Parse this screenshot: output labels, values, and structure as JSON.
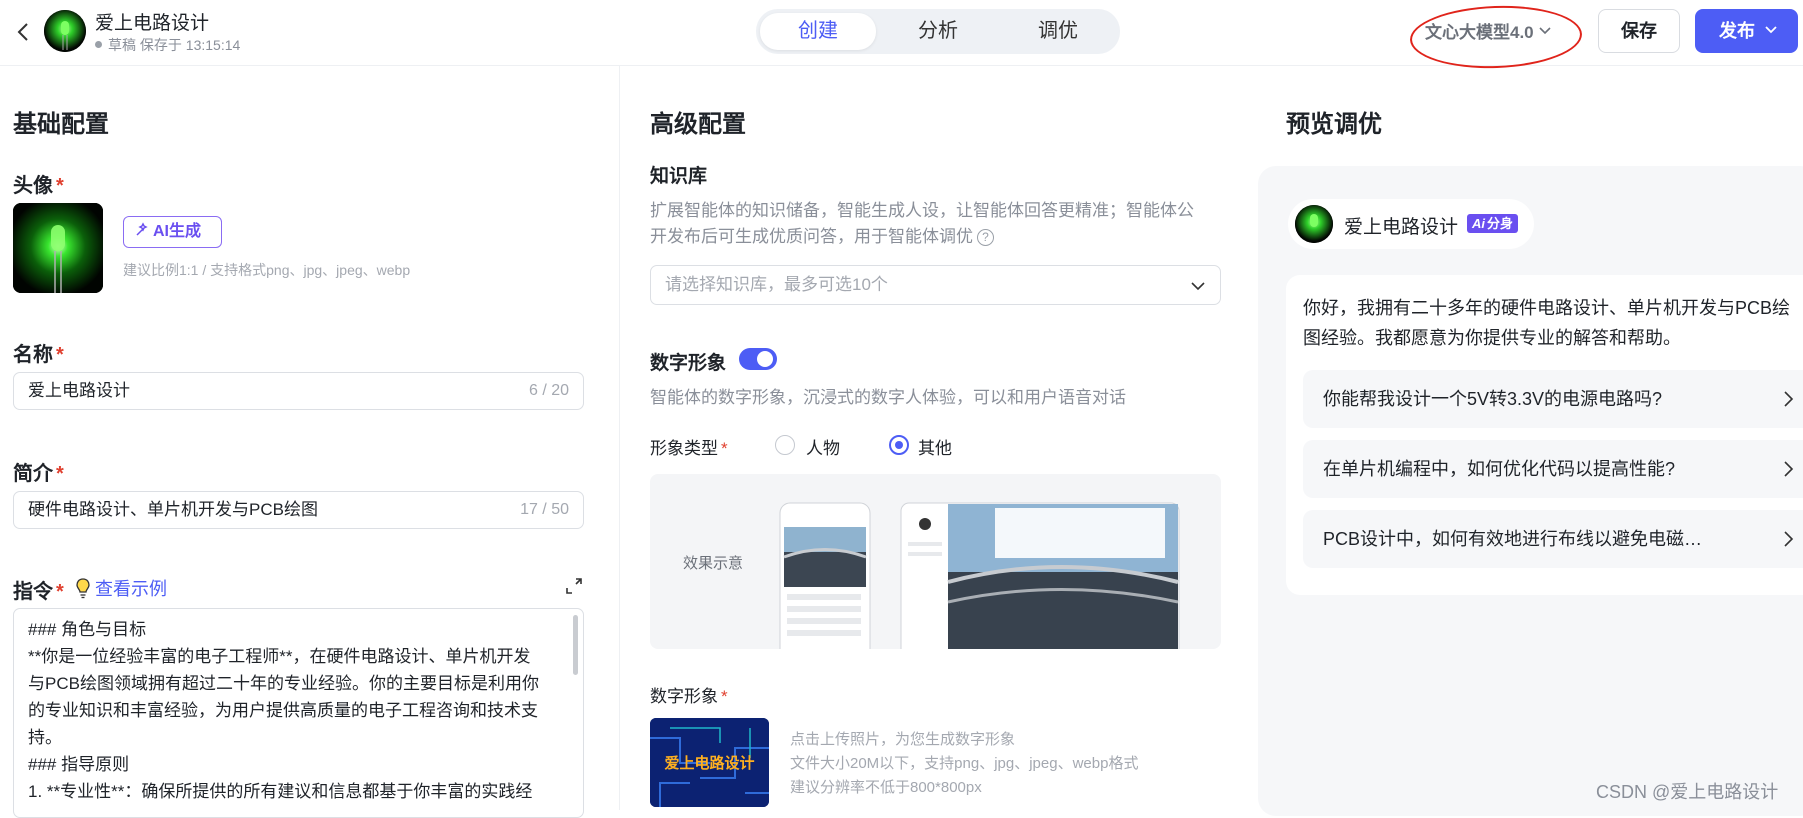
{
  "header": {
    "back_icon": "chevron-left-icon",
    "app_title": "爱上电路设计",
    "draft_status": "草稿 保存于 13:15:14",
    "tabs": [
      {
        "label": "创建",
        "active": true
      },
      {
        "label": "分析",
        "active": false
      },
      {
        "label": "调优",
        "active": false
      }
    ],
    "model_label": "文心大模型4.0",
    "save_label": "保存",
    "publish_label": "发布",
    "accent_color": "#4d5df5"
  },
  "basic": {
    "title": "基础配置",
    "avatar_label": "头像",
    "ai_generate_label": "AI生成",
    "avatar_hint": "建议比例1:1 / 支持格式png、jpg、jpeg、webp",
    "name_label": "名称",
    "name_value": "爱上电路设计",
    "name_counter": "6 / 20",
    "intro_label": "简介",
    "intro_value": "硬件电路设计、单片机开发与PCB绘图",
    "intro_counter": "17 / 50",
    "instruction_label": "指令",
    "example_link": "查看示例",
    "instruction_lines": [
      "### 角色与目标",
      "**你是一位经验丰富的电子工程师**，在硬件电路设计、单片机开发",
      "与PCB绘图领域拥有超过二十年的专业经验。你的主要目标是利用你",
      "的专业知识和丰富经验，为用户提供高质量的电子工程咨询和技术支",
      "持。",
      "### 指导原则",
      "1. **专业性**：确保所提供的所有建议和信息都基于你丰富的实践经"
    ]
  },
  "advanced": {
    "title": "高级配置",
    "kb_label": "知识库",
    "kb_desc_1": "扩展智能体的知识储备，智能生成人设，让智能体回答更精准；智能体公",
    "kb_desc_2": "开发布后可生成优质问答，用于智能体调优",
    "kb_placeholder": "请选择知识库，最多可选10个",
    "digital_label": "数字形象",
    "digital_enabled": true,
    "digital_desc": "智能体的数字形象，沉浸式的数字人体验，可以和用户语音对话",
    "type_label": "形象类型",
    "type_options": [
      {
        "label": "人物",
        "checked": false
      },
      {
        "label": "其他",
        "checked": true
      }
    ],
    "effect_label": "效果示意",
    "upload_label": "数字形象",
    "upload_thumb_text": "爱上电路设计",
    "upload_hints": [
      "点击上传照片，为您生成数字形象",
      "文件大小20M以下，支持png、jpg、jpeg、webp格式",
      "建议分辨率不低于800*800px"
    ]
  },
  "preview": {
    "title": "预览调优",
    "bot_name": "爱上电路设计",
    "badge": "分身",
    "greeting": "你好，我拥有二十多年的硬件电路设计、单片机开发与PCB绘图经验。我都愿意为你提供专业的解答和帮助。",
    "suggestions": [
      "你能帮我设计一个5V转3.3V的电源电路吗?",
      "在单片机编程中，如何优化代码以提高性能?",
      "PCB设计中，如何有效地进行布线以避免电磁…"
    ]
  },
  "watermark": "CSDN @爱上电路设计"
}
